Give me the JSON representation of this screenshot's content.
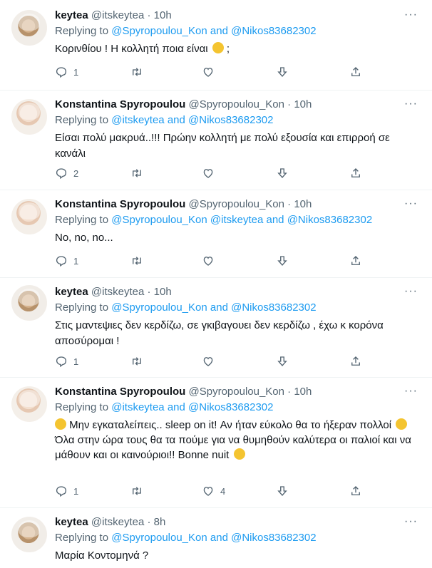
{
  "tweets": [
    {
      "name": "keytea",
      "handle": "@itskeytea",
      "time": "10h",
      "replying_prefix": "Replying to",
      "mention1": "@Spyropoulou_Kon",
      "joiner": "and",
      "mention2": "@Nikos83682302",
      "text": "Κορινθίου ! Η κολλητή ποια είναι",
      "text_suffix": ";",
      "replies": "1",
      "retweets": "",
      "likes": ""
    },
    {
      "name": "Konstantina Spyropoulou",
      "handle": "@Spyropoulou_Kon",
      "time": "10h",
      "replying_prefix": "Replying to",
      "mention1": "@itskeytea",
      "joiner": "and",
      "mention2": "@Nikos83682302",
      "text": "Είσαι πολύ μακρυά..!!! Πρώην κολλητή με πολύ εξουσία και επιρροή σε κανάλι",
      "replies": "2",
      "retweets": "",
      "likes": ""
    },
    {
      "name": "Konstantina Spyropoulou",
      "handle": "@Spyropoulou_Kon",
      "time": "10h",
      "replying_prefix": "Replying to",
      "mention1": "@Spyropoulou_Kon",
      "mention1b": "@itskeytea",
      "joiner": "and",
      "mention2": "@Nikos83682302",
      "text": "No, no, no...",
      "replies": "1",
      "retweets": "",
      "likes": ""
    },
    {
      "name": "keytea",
      "handle": "@itskeytea",
      "time": "10h",
      "replying_prefix": "Replying to",
      "mention1": "@Spyropoulou_Kon",
      "joiner": "and",
      "mention2": "@Nikos83682302",
      "text": "Στις μαντεψιες δεν κερδίζω, σε γκιβαγουει δεν κερδίζω , έχω κ κορόνα αποσύρομαι !",
      "replies": "1",
      "retweets": "",
      "likes": ""
    },
    {
      "name": "Konstantina Spyropoulou",
      "handle": "@Spyropoulou_Kon",
      "time": "10h",
      "replying_prefix": "Replying to",
      "mention1": "@itskeytea",
      "joiner": "and",
      "mention2": "@Nikos83682302",
      "text_line1": "Μην εγκαταλείπεις.. sleep on it! Αν ήταν εύκολο θα το ήξεραν πολλοί",
      "text_line2": "Όλα στην ώρα τους θα τα πούμε για να θυμηθούν καλύτερα οι παλιοί και να μάθουν και οι καινούριοι!! Bonne nuit",
      "replies": "1",
      "retweets": "",
      "likes": "4"
    },
    {
      "name": "keytea",
      "handle": "@itskeytea",
      "time": "8h",
      "replying_prefix": "Replying to",
      "mention1": "@Spyropoulou_Kon",
      "joiner": "and",
      "mention2": "@Nikos83682302",
      "text": "Μαρία Κοντομηνά ?"
    }
  ],
  "separator": "·",
  "more_label": "···",
  "icons": [
    "reply-icon",
    "retweet-icon",
    "like-icon",
    "downvote-icon",
    "share-icon",
    "more-icon"
  ],
  "colors": {
    "link": "#1d9bf0",
    "muted": "#536471",
    "text": "#0f1419"
  }
}
